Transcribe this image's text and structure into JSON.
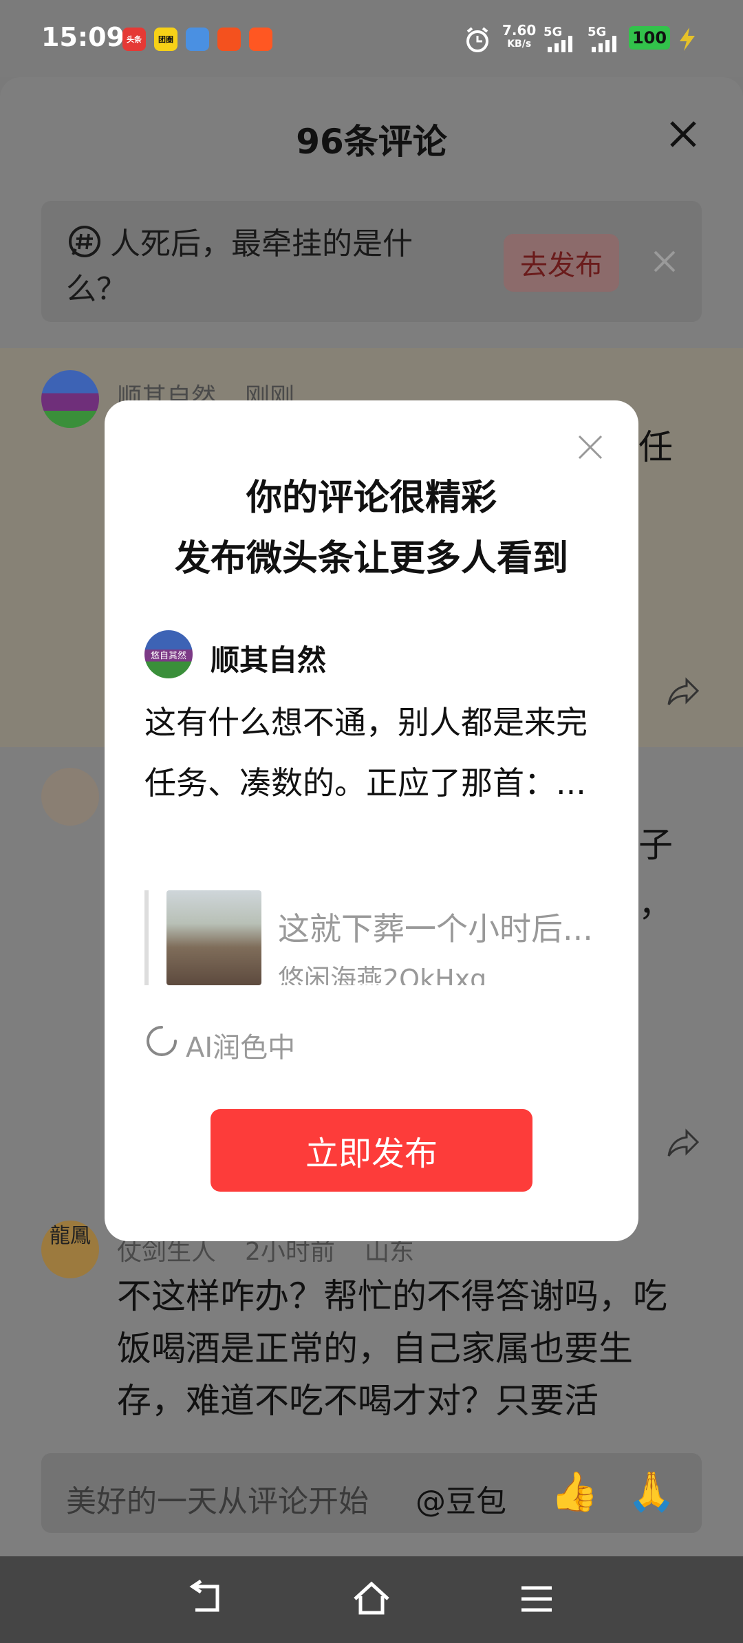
{
  "status_bar": {
    "time": "15:09",
    "apps": [
      "头条",
      "团圈",
      "",
      "",
      ""
    ],
    "net_speed": "7.60",
    "net_unit": "KB/s",
    "signal1": "5G",
    "signal2": "5G",
    "battery": "100"
  },
  "sheet": {
    "title": "96条评论",
    "topic": {
      "text": "人死后，最牵挂的是什么？",
      "button": "去发布"
    }
  },
  "comments": [
    {
      "user": "顺其自然",
      "time": "刚刚",
      "snippet": "任"
    },
    {
      "snippet1": "子",
      "snippet2": "，"
    },
    {
      "user": "仗剑生人",
      "time": "2小时前",
      "location": "山东",
      "avatar_text": "龍鳳",
      "body": "不这样咋办？帮忙的不得答谢吗，吃饭喝酒是正常的，自己家属也要生存，难道不吃不喝才对？只要活"
    }
  ],
  "modal": {
    "title_line1": "你的评论很精彩",
    "title_line2": "发布微头条让更多人看到",
    "user": "顺其自然",
    "avatar_text": "悠自其然",
    "body": "这有什么想不通，别人都是来完任务、凑数的。正应了那首：...",
    "quote_title": "这就下葬一个小时后...",
    "quote_author": "悠闲海燕2QkHxq",
    "ai_status": "AI润色中",
    "publish_button": "立即发布"
  },
  "input_bar": {
    "placeholder": "美好的一天从评论开始",
    "mention": "@豆包"
  },
  "colors": {
    "accent_red": "#fd3c3a",
    "battery_green": "#32c24b"
  }
}
